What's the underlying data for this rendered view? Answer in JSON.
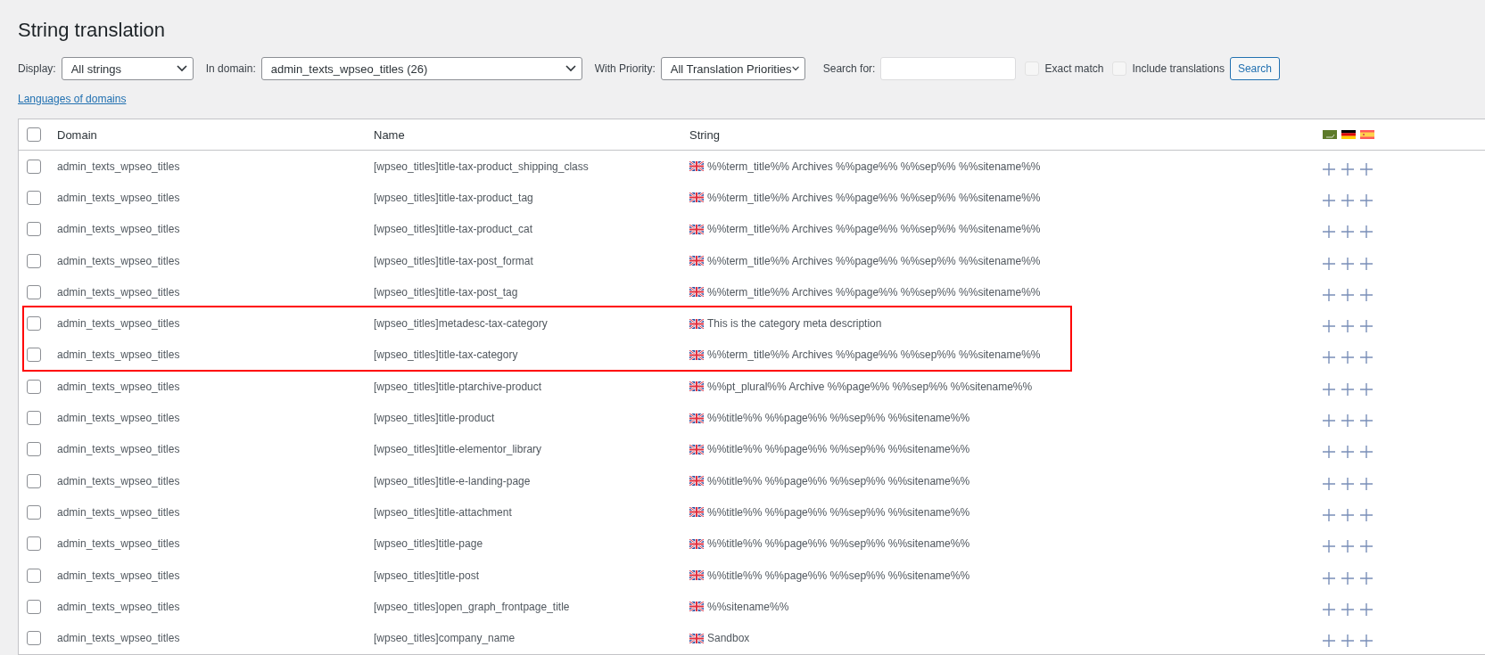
{
  "page_title": "String translation",
  "filters": {
    "display": {
      "label": "Display:",
      "value": "All strings"
    },
    "domain": {
      "label": "In domain:",
      "value": "admin_texts_wpseo_titles (26)"
    },
    "priority": {
      "label": "With Priority:",
      "value": "All Translation Priorities"
    },
    "search": {
      "label": "Search for:"
    },
    "exact_match": {
      "label": "Exact match",
      "checked": false
    },
    "include_translations": {
      "label": "Include translations",
      "checked": false
    },
    "search_button": "Search"
  },
  "languages_link": "Languages of domains",
  "table": {
    "select_all_checked": false,
    "columns": [
      "Domain",
      "Name",
      "String"
    ],
    "languages": [
      {
        "kind": "ar"
      },
      {
        "kind": "de"
      },
      {
        "kind": "es"
      }
    ],
    "rows": [
      {
        "domain": "admin_texts_wpseo_titles",
        "name": "[wpseo_titles]title-tax-product_shipping_class",
        "string": "%%term_title%% Archives %%page%% %%sep%% %%sitename%%",
        "checked": false,
        "highlighted": false
      },
      {
        "domain": "admin_texts_wpseo_titles",
        "name": "[wpseo_titles]title-tax-product_tag",
        "string": "%%term_title%% Archives %%page%% %%sep%% %%sitename%%",
        "checked": false,
        "highlighted": false
      },
      {
        "domain": "admin_texts_wpseo_titles",
        "name": "[wpseo_titles]title-tax-product_cat",
        "string": "%%term_title%% Archives %%page%% %%sep%% %%sitename%%",
        "checked": false,
        "highlighted": false
      },
      {
        "domain": "admin_texts_wpseo_titles",
        "name": "[wpseo_titles]title-tax-post_format",
        "string": "%%term_title%% Archives %%page%% %%sep%% %%sitename%%",
        "checked": false,
        "highlighted": false
      },
      {
        "domain": "admin_texts_wpseo_titles",
        "name": "[wpseo_titles]title-tax-post_tag",
        "string": "%%term_title%% Archives %%page%% %%sep%% %%sitename%%",
        "checked": false,
        "highlighted": false
      },
      {
        "domain": "admin_texts_wpseo_titles",
        "name": "[wpseo_titles]metadesc-tax-category",
        "string": "This is the category meta description",
        "checked": false,
        "highlighted": true
      },
      {
        "domain": "admin_texts_wpseo_titles",
        "name": "[wpseo_titles]title-tax-category",
        "string": "%%term_title%% Archives %%page%% %%sep%% %%sitename%%",
        "checked": false,
        "highlighted": true
      },
      {
        "domain": "admin_texts_wpseo_titles",
        "name": "[wpseo_titles]title-ptarchive-product",
        "string": "%%pt_plural%% Archive %%page%% %%sep%% %%sitename%%",
        "checked": false,
        "highlighted": false
      },
      {
        "domain": "admin_texts_wpseo_titles",
        "name": "[wpseo_titles]title-product",
        "string": "%%title%% %%page%% %%sep%% %%sitename%%",
        "checked": false,
        "highlighted": false
      },
      {
        "domain": "admin_texts_wpseo_titles",
        "name": "[wpseo_titles]title-elementor_library",
        "string": "%%title%% %%page%% %%sep%% %%sitename%%",
        "checked": false,
        "highlighted": false
      },
      {
        "domain": "admin_texts_wpseo_titles",
        "name": "[wpseo_titles]title-e-landing-page",
        "string": "%%title%% %%page%% %%sep%% %%sitename%%",
        "checked": false,
        "highlighted": false
      },
      {
        "domain": "admin_texts_wpseo_titles",
        "name": "[wpseo_titles]title-attachment",
        "string": "%%title%% %%page%% %%sep%% %%sitename%%",
        "checked": false,
        "highlighted": false
      },
      {
        "domain": "admin_texts_wpseo_titles",
        "name": "[wpseo_titles]title-page",
        "string": "%%title%% %%page%% %%sep%% %%sitename%%",
        "checked": false,
        "highlighted": false
      },
      {
        "domain": "admin_texts_wpseo_titles",
        "name": "[wpseo_titles]title-post",
        "string": "%%title%% %%page%% %%sep%% %%sitename%%",
        "checked": false,
        "highlighted": false
      },
      {
        "domain": "admin_texts_wpseo_titles",
        "name": "[wpseo_titles]open_graph_frontpage_title",
        "string": "%%sitename%%",
        "checked": false,
        "highlighted": false
      },
      {
        "domain": "admin_texts_wpseo_titles",
        "name": "[wpseo_titles]company_name",
        "string": "Sandbox",
        "checked": false,
        "highlighted": false
      }
    ]
  }
}
